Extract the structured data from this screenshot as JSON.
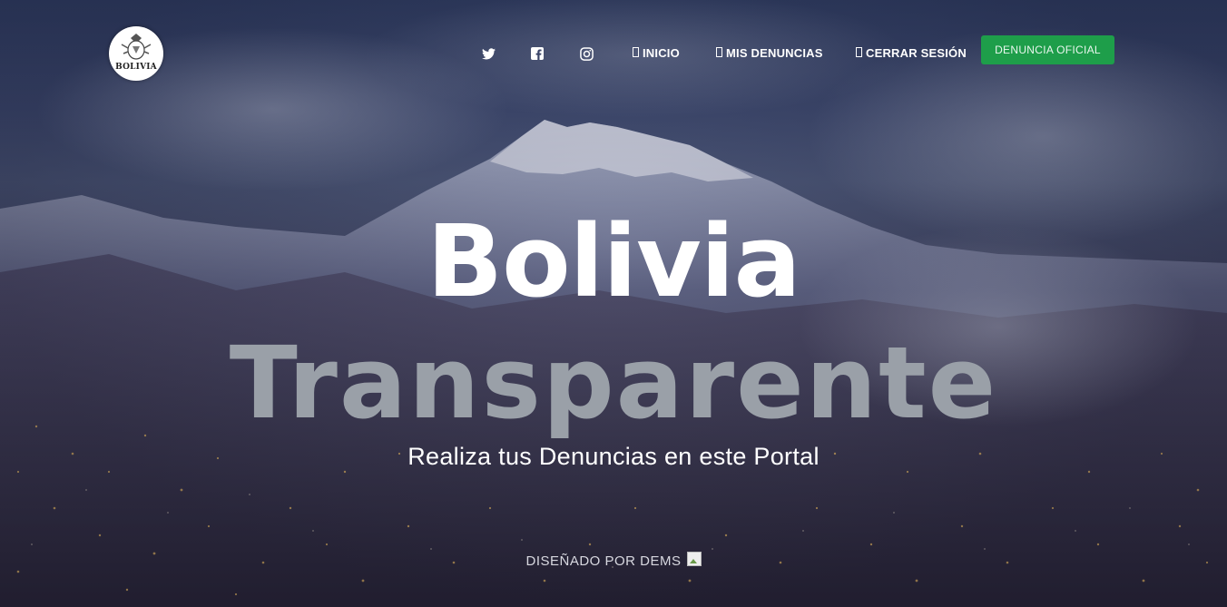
{
  "brand": {
    "logo_text": "BOLIVIA"
  },
  "nav": {
    "social_icons": [
      "twitter-icon",
      "facebook-icon",
      "instagram-icon"
    ],
    "links": [
      {
        "label": "INICIO",
        "icon": "home-icon"
      },
      {
        "label": "MIS DENUNCIAS",
        "icon": "document-icon"
      },
      {
        "label": "CERRAR SESIÓN",
        "icon": "logout-icon"
      }
    ],
    "cta_label": "DENUNCIA OFICIAL"
  },
  "hero": {
    "title_line1": "Bolivia",
    "title_line2": "Transparente",
    "subtitle": "Realiza tus Denuncias en este Portal"
  },
  "footer": {
    "credit": "DISEÑADO POR DEMS"
  },
  "colors": {
    "cta_background": "#1e9e4a",
    "title_primary": "#ffffff",
    "title_secondary": "#9aa0a8"
  }
}
